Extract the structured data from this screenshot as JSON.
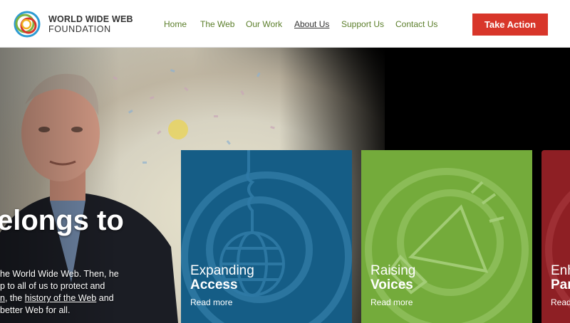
{
  "logo": {
    "line1": "WORLD WIDE WEB",
    "line2": "FOUNDATION"
  },
  "nav": [
    {
      "label": "Home"
    },
    {
      "label": "The Web"
    },
    {
      "label": "Our Work"
    },
    {
      "label": "About Us",
      "active": true
    },
    {
      "label": "Support Us"
    },
    {
      "label": "Contact Us"
    }
  ],
  "cta": {
    "label": "Take Action"
  },
  "hero": {
    "title": "elongs to",
    "text": {
      "line1": "he World Wide Web. Then, he",
      "line2": "p to all of us to protect and",
      "line3_link": "n",
      "line3_mid": ", the ",
      "line3_link2": "history of the Web",
      "line3_end": " and",
      "line4": "better Web for all."
    }
  },
  "cards": [
    {
      "line1": "Expanding",
      "line2": "Access",
      "more": "Read more",
      "color": "#155d86"
    },
    {
      "line1": "Raising",
      "line2": "Voices",
      "more": "Read more",
      "color": "#74ab3b"
    },
    {
      "line1": "Enh",
      "line2": "Par",
      "more": "Read",
      "color": "#8e1f24"
    }
  ],
  "colors": {
    "nav": "#5b7e2a",
    "cta": "#d8362a"
  }
}
